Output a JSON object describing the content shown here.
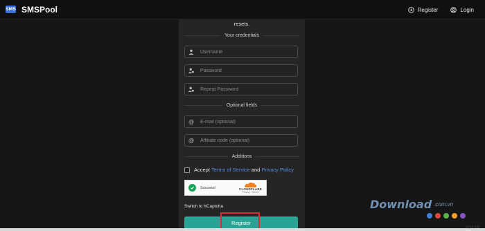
{
  "navbar": {
    "brand_logo": "SMS",
    "brand_name": "SMSPool",
    "register_label": "Register",
    "login_label": "Login"
  },
  "form": {
    "top_text": "resets.",
    "credentials_title": "Your credentials",
    "username_placeholder": "Username",
    "password_placeholder": "Password",
    "repeat_password_placeholder": "Repeat Password",
    "optional_title": "Optional fields",
    "email_placeholder": "E-mail (optional)",
    "affiliate_placeholder": "Affiliate code (optional)",
    "additions_title": "Additions",
    "accept_prefix": "Accept",
    "terms_link": "Terms of Service",
    "accept_and": "and",
    "privacy_link": "Privacy Policy",
    "captcha_status": "Success!",
    "captcha_brand": "CLOUDFLARE",
    "captcha_sub": "Privacy · Terms",
    "switch_captcha": "Switch to hCaptcha",
    "register_button": "Register"
  },
  "watermark": {
    "text": "Download",
    "domain": ".com.vn",
    "dot_colors": [
      "#3f7fd6",
      "#d94a3a",
      "#5bb04a",
      "#f0a020",
      "#8a56c2"
    ]
  },
  "taskbar": {
    "time": "10:10 AM"
  }
}
